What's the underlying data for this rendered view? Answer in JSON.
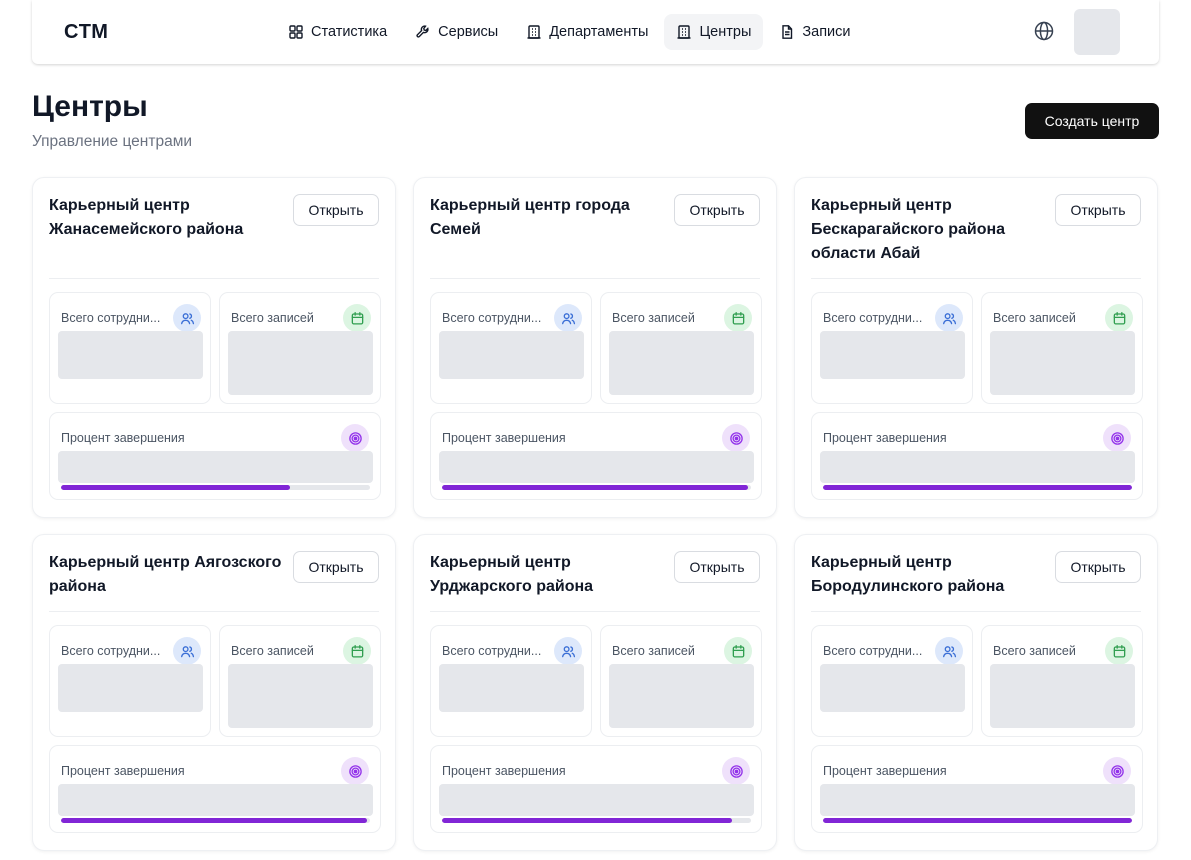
{
  "header": {
    "logo": "CTM",
    "nav": [
      {
        "label": "Статистика",
        "icon": "grid-icon",
        "active": false
      },
      {
        "label": "Сервисы",
        "icon": "wrench-icon",
        "active": false
      },
      {
        "label": "Департаменты",
        "icon": "building-icon",
        "active": false
      },
      {
        "label": "Центры",
        "icon": "building-icon",
        "active": true
      },
      {
        "label": "Записи",
        "icon": "document-icon",
        "active": false
      }
    ]
  },
  "page": {
    "title": "Центры",
    "subtitle": "Управление центрами",
    "create_label": "Создать центр"
  },
  "card_labels": {
    "open": "Открыть",
    "employees": "Всего сотрудни...",
    "records": "Всего записей",
    "completion": "Процент завершения"
  },
  "cards": [
    {
      "title": "Карьерный центр Жанасемейского района",
      "completion": 0.74
    },
    {
      "title": "Карьерный центр города Семей",
      "completion": 0.99
    },
    {
      "title": "Карьерный центр Бескарагайского района области Абай",
      "completion": 1.0
    },
    {
      "title": "Карьерный центр Аягозского района",
      "completion": 0.99
    },
    {
      "title": "Карьерный центр Урджарского района",
      "completion": 0.94
    },
    {
      "title": "Карьерный центр Бородулинского района",
      "completion": 1.0
    }
  ],
  "colors": {
    "accent": "#8126d6",
    "primary_button": "#111111",
    "skeleton": "#e5e7eb"
  }
}
